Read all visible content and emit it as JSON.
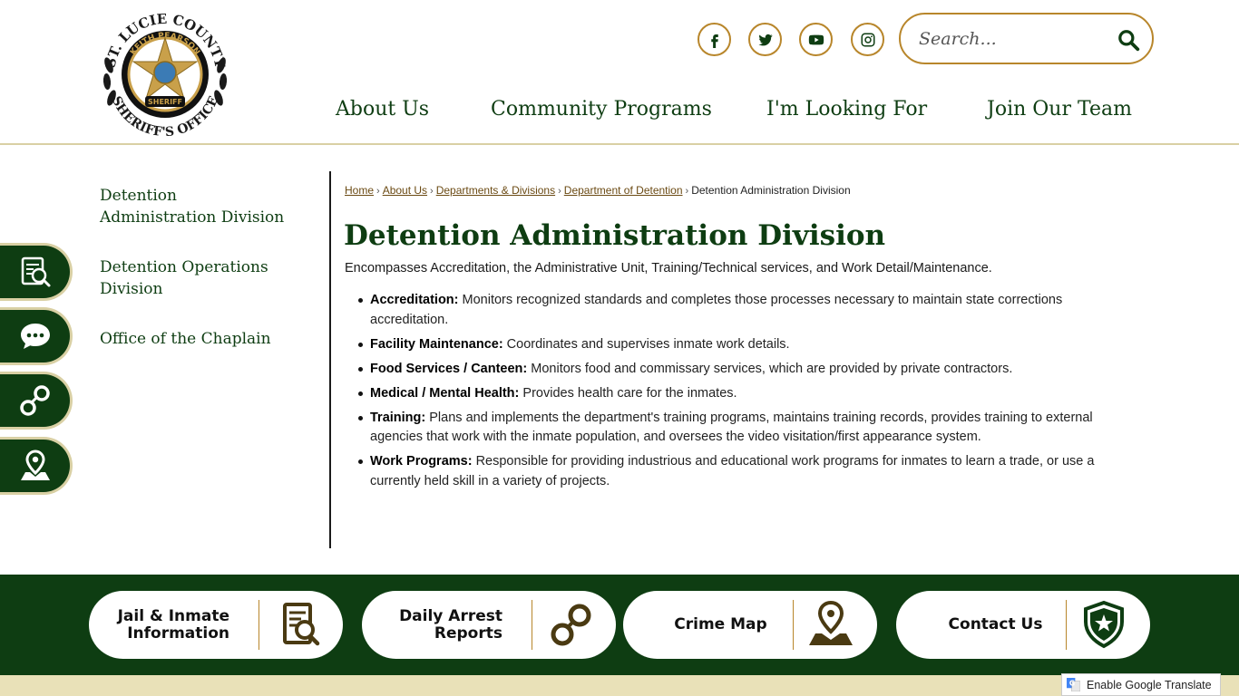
{
  "header": {
    "logo": {
      "top_text": "ST. LUCIE COUNTY",
      "name_text": "KEITH PEARSON",
      "badge_text": "SHERIFF",
      "bottom_text": "SHERIFF'S OFFICE"
    },
    "social": [
      {
        "name": "facebook-icon"
      },
      {
        "name": "twitter-icon"
      },
      {
        "name": "youtube-icon"
      },
      {
        "name": "instagram-icon"
      }
    ],
    "search": {
      "placeholder": "Search..."
    },
    "nav": [
      "About Us",
      "Community Programs",
      "I'm Looking For",
      "Join Our Team"
    ]
  },
  "floating_buttons": [
    {
      "icon": "inmate-info-icon"
    },
    {
      "icon": "chat-icon"
    },
    {
      "icon": "handcuffs-icon"
    },
    {
      "icon": "map-pin-icon"
    }
  ],
  "subnav": [
    "Detention Administration Division",
    "Detention Operations Division",
    "Office of the Chaplain"
  ],
  "breadcrumb": {
    "links": [
      "Home",
      "About Us",
      "Departments & Divisions",
      "Department of Detention"
    ],
    "current": "Detention Administration Division"
  },
  "main": {
    "title": "Detention Administration Division",
    "intro": "Encompasses Accreditation, the Administrative Unit, Training/Technical services, and Work Detail/Maintenance.",
    "items": [
      {
        "term": "Accreditation:",
        "text": " Monitors recognized standards and completes those processes necessary to maintain state corrections accreditation."
      },
      {
        "term": "Facility Maintenance:",
        "text": " Coordinates and supervises inmate work details."
      },
      {
        "term": "Food Services / Canteen:",
        "text": " Monitors food and commissary services, which are provided by private contractors."
      },
      {
        "term": "Medical / Mental Health:",
        "text": " Provides health care for the inmates."
      },
      {
        "term": "Training:",
        "text": " Plans and implements the department's training programs, maintains training records, provides training to external agencies that work with the inmate population, and oversees the video visitation/first appearance system."
      },
      {
        "term": "Work Programs:",
        "text": " Responsible for providing industrious and educational work programs for inmates to learn a trade, or use a currently held skill in a variety of projects."
      }
    ]
  },
  "footer": {
    "buttons": [
      {
        "line1": "Jail & Inmate",
        "line2": "Information",
        "icon": "inmate-info-icon"
      },
      {
        "line1": "Daily Arrest",
        "line2": "Reports",
        "icon": "handcuffs-icon"
      },
      {
        "line1": "Crime Map",
        "line2": "",
        "icon": "map-pin-icon"
      },
      {
        "line1": "Contact Us",
        "line2": "",
        "icon": "shield-star-icon"
      }
    ],
    "translate_label": "Enable Google Translate"
  },
  "colors": {
    "primary_green": "#0e3d12",
    "gold": "#b8862b",
    "cream": "#e9e1b8"
  }
}
